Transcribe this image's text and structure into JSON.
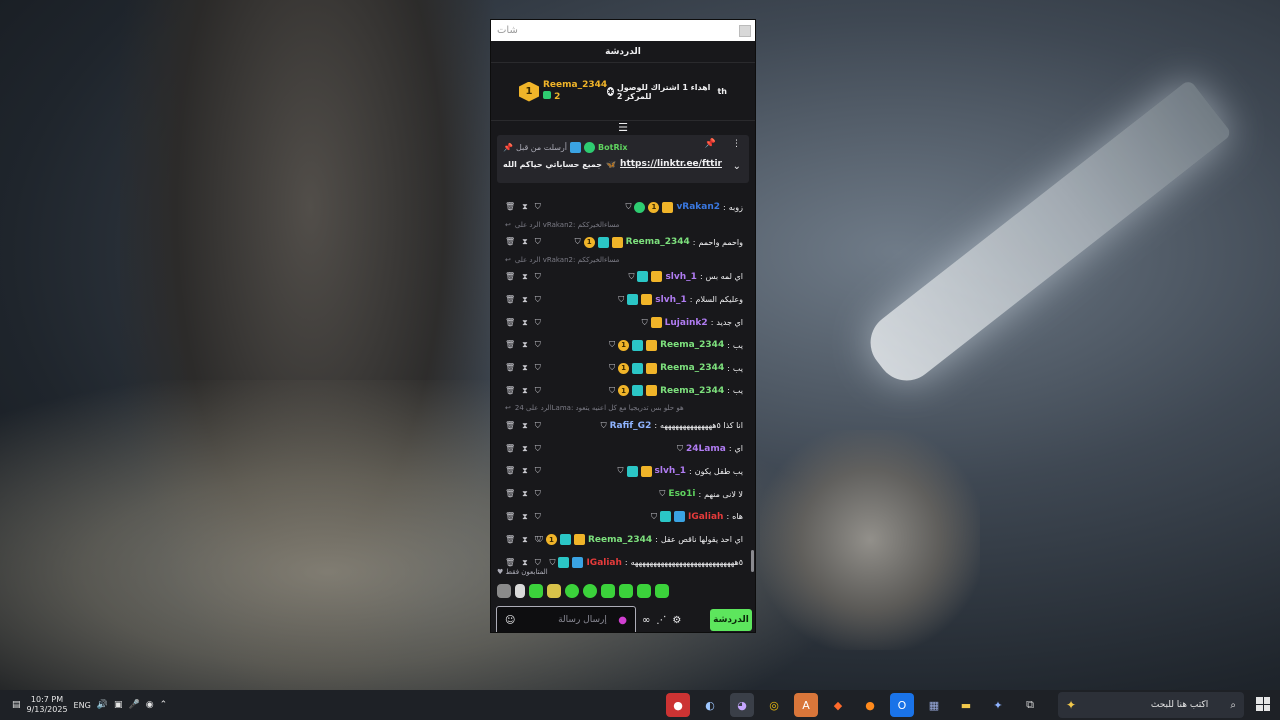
{
  "window": {
    "title": "شات"
  },
  "chat": {
    "header": "الدردشة"
  },
  "hype": {
    "rank": "1",
    "username": "Reema_2344",
    "gifts": "2",
    "goal_text": "اهداء 1 اشتراك للوصول للمركز 2",
    "suffix": "th"
  },
  "pinned": {
    "sent_by": "أرسلت من قبل",
    "bot": "BotRix",
    "text": "جميع حساباتي حياكم الله",
    "link": "https://linktr.ee/fttir"
  },
  "messages": [
    {
      "type": "msg",
      "user": "vRakan2",
      "color": "#3a78e0",
      "text": "زوبه",
      "badges": [
        "gold",
        "coin",
        "green"
      ]
    },
    {
      "type": "reply",
      "text": "الرد على vRakan2: مساءالخيرككم"
    },
    {
      "type": "msg",
      "user": "Reema_2344",
      "color": "#7de07d",
      "text": "واحمم واحمم",
      "badges": [
        "gold",
        "teal",
        "coin"
      ]
    },
    {
      "type": "reply",
      "text": "الرد على vRakan2: مساءالخيرككم"
    },
    {
      "type": "msg",
      "user": "slvh_1",
      "color": "#b07cf2",
      "text": "اي لمه بس",
      "badges": [
        "gold",
        "teal"
      ]
    },
    {
      "type": "msg",
      "user": "slvh_1",
      "color": "#b07cf2",
      "text": "وعليكم السلام",
      "badges": [
        "gold",
        "teal"
      ]
    },
    {
      "type": "msg",
      "user": "Lujaink2",
      "color": "#b07cf2",
      "text": "اي جديد",
      "badges": [
        "gold"
      ]
    },
    {
      "type": "msg",
      "user": "Reema_2344",
      "color": "#7de07d",
      "text": "يب",
      "badges": [
        "gold",
        "teal",
        "coin"
      ]
    },
    {
      "type": "msg",
      "user": "Reema_2344",
      "color": "#7de07d",
      "text": "يب",
      "badges": [
        "gold",
        "teal",
        "coin"
      ]
    },
    {
      "type": "msg",
      "user": "Reema_2344",
      "color": "#7de07d",
      "text": "يب",
      "badges": [
        "gold",
        "teal",
        "coin"
      ]
    },
    {
      "type": "reply",
      "text": "الرد على 24Lama: هو حلو بس تدريجيا مع كل اعنيه يتعود"
    },
    {
      "type": "msg",
      "user": "Rafif_G2",
      "color": "#8fb4ff",
      "text": "انا كذا ٥ههههههههههههههه",
      "badges": []
    },
    {
      "type": "msg",
      "user": "24Lama",
      "color": "#b07cf2",
      "text": "اي",
      "badges": []
    },
    {
      "type": "msg",
      "user": "slvh_1",
      "color": "#b07cf2",
      "text": "يب طفل يكون",
      "badges": [
        "gold",
        "teal"
      ]
    },
    {
      "type": "msg",
      "user": "Eso1i",
      "color": "#5fd35f",
      "text": "لا لانى منهم",
      "badges": []
    },
    {
      "type": "msg",
      "user": "IGaliah",
      "color": "#e63b3b",
      "text": "هاه",
      "badges": [
        "blue",
        "teal"
      ]
    },
    {
      "type": "msg",
      "user": "Reema_2344",
      "color": "#7de07d",
      "text": "اي احد يقولها ناقص عقل",
      "badges": [
        "gold",
        "teal",
        "coin"
      ]
    },
    {
      "type": "msg",
      "user": "IGaliah",
      "color": "#e63b3b",
      "text": "٥ههههههههههههههههههههههههههههه",
      "badges": [
        "blue",
        "teal"
      ]
    },
    {
      "type": "msg",
      "user": "Rafif_G2",
      "color": "#8fb4ff",
      "text": "راكان طفل من اول يوكم تعرفون",
      "badges": []
    }
  ],
  "supporters_label": "المتابعون فقط",
  "input": {
    "placeholder": "إرسال رسالة"
  },
  "send_label": "الدردشة",
  "taskbar": {
    "time": "10:7 PM",
    "date": "9/13/2025",
    "lang": "ENG",
    "search_placeholder": "اكتب هنا للبحث"
  }
}
